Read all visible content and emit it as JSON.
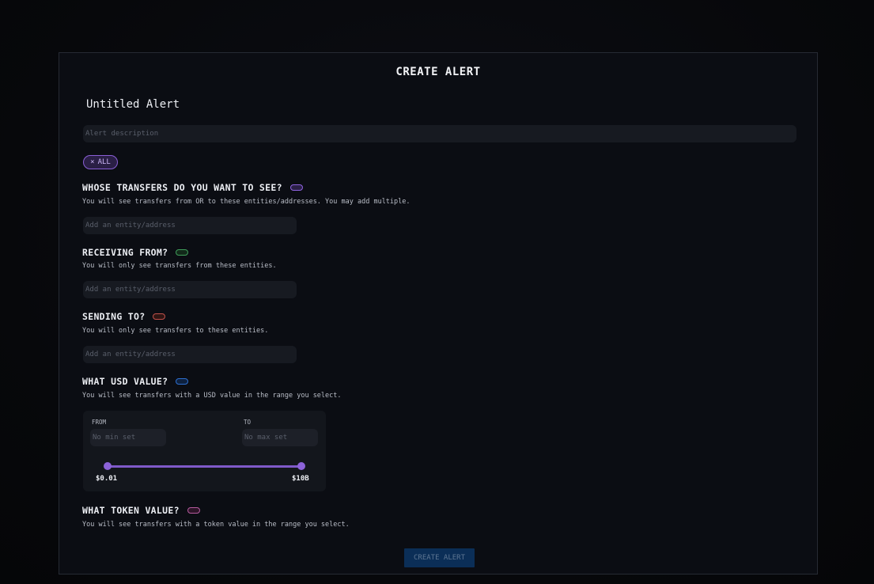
{
  "modal": {
    "title": "CREATE ALERT",
    "alert_name": "Untitled Alert",
    "description_placeholder": "Alert description",
    "chip": {
      "icon": "x-icon",
      "icon_glyph": "×",
      "label": "ALL",
      "color": "#8a5fd6"
    }
  },
  "sections": [
    {
      "title": "WHOSE TRANSFERS DO YOU WANT TO SEE?",
      "subtitle": "You will see transfers from OR to these entities/addresses. You may add multiple.",
      "placeholder": "Add an entity/address",
      "toggle_color": "#8f63e0"
    },
    {
      "title": "RECEIVING FROM?",
      "subtitle": "You will only see transfers from these entities.",
      "placeholder": "Add an entity/address",
      "toggle_color": "#3f9c5a"
    },
    {
      "title": "SENDING TO?",
      "subtitle": "You will only see transfers to these entities.",
      "placeholder": "Add an entity/address",
      "toggle_color": "#c0504a"
    },
    {
      "title": "WHAT USD VALUE?",
      "subtitle": "You will see transfers with a USD value in the range you select.",
      "toggle_color": "#2d6fd0"
    },
    {
      "title": "WHAT TOKEN VALUE?",
      "subtitle": "You will see transfers with a token value in the range you select.",
      "toggle_color": "#b55a9e"
    }
  ],
  "usd_range": {
    "from_label": "FROM",
    "to_label": "TO",
    "min_placeholder": "No min set",
    "max_placeholder": "No max set",
    "slider_min_label": "$0.01",
    "slider_max_label": "$10B",
    "slider_color": "#7f5ac9"
  },
  "footer": {
    "create_button": "CREATE ALERT",
    "button_color": "#0b2e57"
  }
}
